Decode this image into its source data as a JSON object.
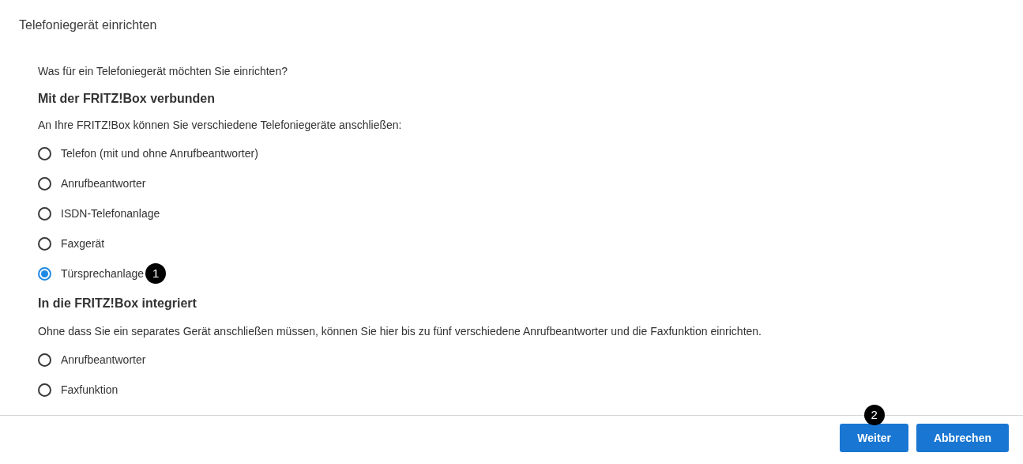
{
  "title": "Telefoniegerät einrichten",
  "question": "Was für ein Telefoniegerät möchten Sie einrichten?",
  "groups": [
    {
      "heading": "Mit der FRITZ!Box verbunden",
      "description": "An Ihre FRITZ!Box können Sie verschiedene Telefoniegeräte anschließen:",
      "options": [
        {
          "label": "Telefon (mit und ohne Anrufbeantworter)",
          "selected": false
        },
        {
          "label": "Anrufbeantworter",
          "selected": false
        },
        {
          "label": "ISDN-Telefonanlage",
          "selected": false
        },
        {
          "label": "Faxgerät",
          "selected": false
        },
        {
          "label": "Türsprechanlage",
          "selected": true,
          "callout": "1"
        }
      ]
    },
    {
      "heading": "In die FRITZ!Box integriert",
      "description": "Ohne dass Sie ein separates Gerät anschließen müssen, können Sie hier bis zu fünf verschiedene Anrufbeantworter und die Faxfunktion einrichten.",
      "options": [
        {
          "label": "Anrufbeantworter",
          "selected": false
        },
        {
          "label": "Faxfunktion",
          "selected": false
        }
      ]
    }
  ],
  "buttons": [
    {
      "label": "Weiter",
      "callout": "2"
    },
    {
      "label": "Abbrechen"
    }
  ]
}
